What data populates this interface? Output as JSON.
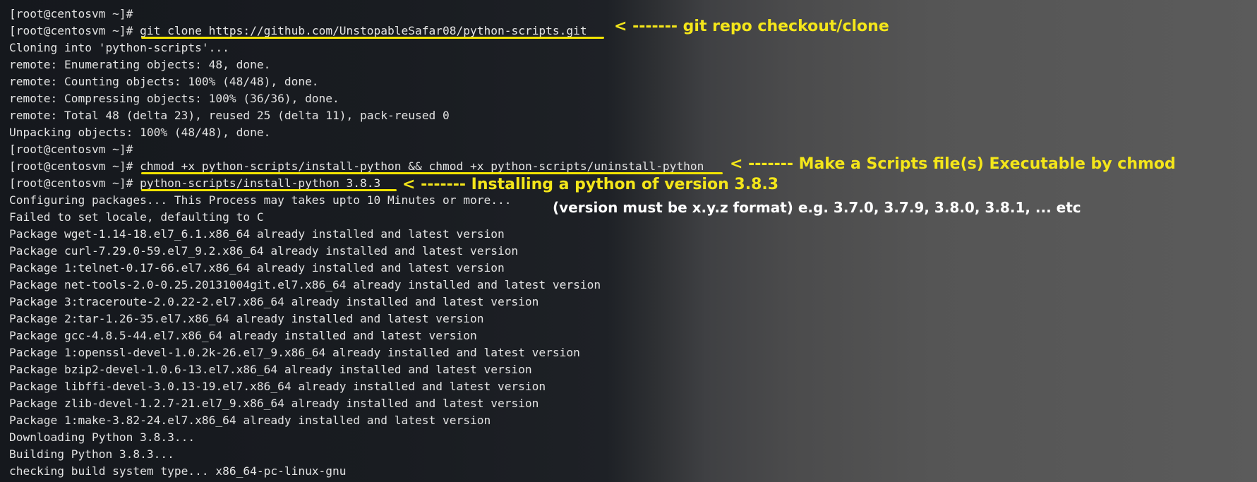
{
  "terminal": {
    "lines": [
      {
        "prompt": "[root@centosvm ~]#",
        "text": ""
      },
      {
        "prompt": "[root@centosvm ~]#",
        "text": " git clone https://github.com/UnstopableSafar08/python-scripts.git"
      },
      {
        "prompt": "",
        "text": "Cloning into 'python-scripts'..."
      },
      {
        "prompt": "",
        "text": "remote: Enumerating objects: 48, done."
      },
      {
        "prompt": "",
        "text": "remote: Counting objects: 100% (48/48), done."
      },
      {
        "prompt": "",
        "text": "remote: Compressing objects: 100% (36/36), done."
      },
      {
        "prompt": "",
        "text": "remote: Total 48 (delta 23), reused 25 (delta 11), pack-reused 0"
      },
      {
        "prompt": "",
        "text": "Unpacking objects: 100% (48/48), done."
      },
      {
        "prompt": "[root@centosvm ~]#",
        "text": ""
      },
      {
        "prompt": "[root@centosvm ~]#",
        "text": " chmod +x python-scripts/install-python && chmod +x python-scripts/uninstall-python"
      },
      {
        "prompt": "[root@centosvm ~]#",
        "text": " python-scripts/install-python 3.8.3"
      },
      {
        "prompt": "",
        "text": "Configuring packages... This Process may takes upto 10 Minutes or more..."
      },
      {
        "prompt": "",
        "text": "Failed to set locale, defaulting to C"
      },
      {
        "prompt": "",
        "text": "Package wget-1.14-18.el7_6.1.x86_64 already installed and latest version"
      },
      {
        "prompt": "",
        "text": "Package curl-7.29.0-59.el7_9.2.x86_64 already installed and latest version"
      },
      {
        "prompt": "",
        "text": "Package 1:telnet-0.17-66.el7.x86_64 already installed and latest version"
      },
      {
        "prompt": "",
        "text": "Package net-tools-2.0-0.25.20131004git.el7.x86_64 already installed and latest version"
      },
      {
        "prompt": "",
        "text": "Package 3:traceroute-2.0.22-2.el7.x86_64 already installed and latest version"
      },
      {
        "prompt": "",
        "text": "Package 2:tar-1.26-35.el7.x86_64 already installed and latest version"
      },
      {
        "prompt": "",
        "text": "Package gcc-4.8.5-44.el7.x86_64 already installed and latest version"
      },
      {
        "prompt": "",
        "text": "Package 1:openssl-devel-1.0.2k-26.el7_9.x86_64 already installed and latest version"
      },
      {
        "prompt": "",
        "text": "Package bzip2-devel-1.0.6-13.el7.x86_64 already installed and latest version"
      },
      {
        "prompt": "",
        "text": "Package libffi-devel-3.0.13-19.el7.x86_64 already installed and latest version"
      },
      {
        "prompt": "",
        "text": "Package zlib-devel-1.2.7-21.el7_9.x86_64 already installed and latest version"
      },
      {
        "prompt": "",
        "text": "Package 1:make-3.82-24.el7.x86_64 already installed and latest version"
      },
      {
        "prompt": "",
        "text": "Downloading Python 3.8.3..."
      },
      {
        "prompt": "",
        "text": "Building Python 3.8.3..."
      },
      {
        "prompt": "",
        "text": "checking build system type... x86_64-pc-linux-gnu"
      }
    ]
  },
  "annotations": {
    "clone": "< ------- git repo checkout/clone",
    "chmod": "< ------- Make a Scripts file(s) Executable by chmod",
    "install": "< ------- Installing a python of version 3.8.3",
    "version_note": "(version must be x.y.z format) e.g. 3.7.0, 3.7.9, 3.8.0, 3.8.1, ... etc"
  },
  "colors": {
    "text": "#e3e3e3",
    "annotation": "#f4e61a",
    "note": "#ffffff",
    "underline": "#f2e400"
  }
}
